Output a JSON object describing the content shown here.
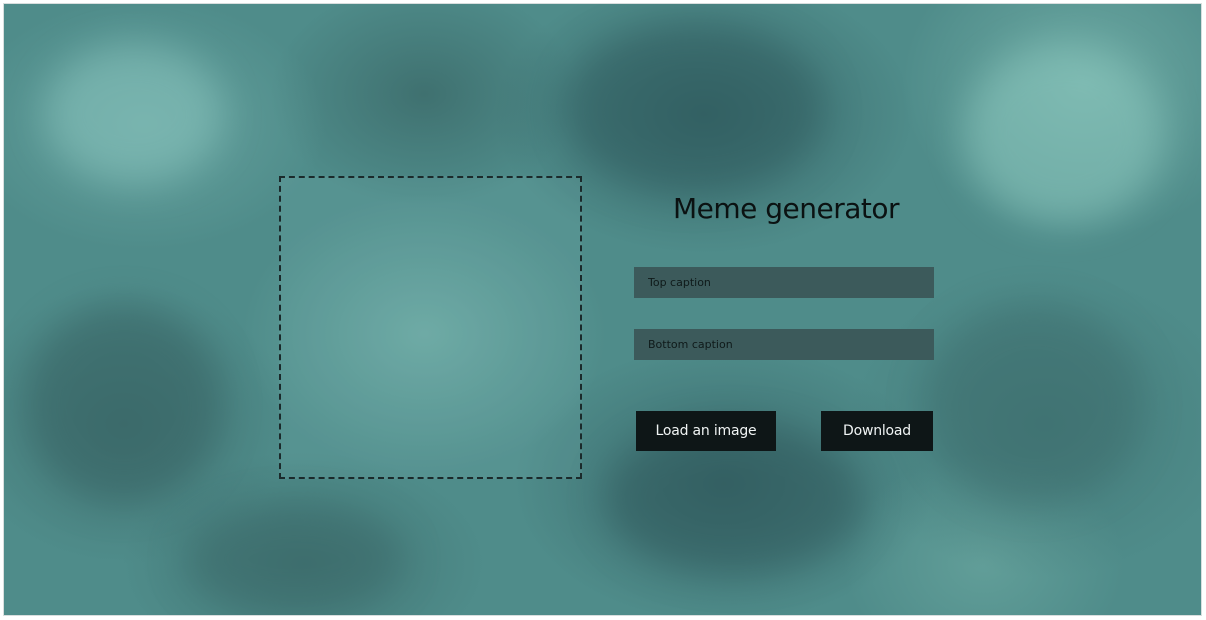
{
  "app": {
    "title": "Meme generator"
  },
  "form": {
    "top_caption_placeholder": "Top caption",
    "top_caption_value": "",
    "bottom_caption_placeholder": "Bottom caption",
    "bottom_caption_value": ""
  },
  "actions": {
    "load_label": "Load an image",
    "download_label": "Download"
  },
  "theme": {
    "background_tint": "#4f8c8a",
    "input_bg": "#3c5a5b",
    "button_bg": "#0e1617",
    "text_dark": "#0b1212"
  }
}
